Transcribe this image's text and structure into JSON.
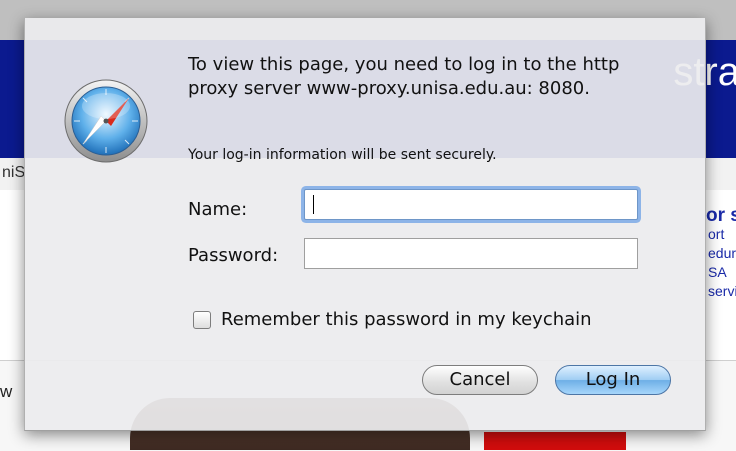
{
  "background": {
    "banner_text": "stra",
    "nav_text": "niS",
    "right_heading": "or s",
    "right_lines": [
      "ort",
      "edure",
      "SA",
      "servi"
    ],
    "lower_left_text": "w"
  },
  "dialog": {
    "title": "To view this page, you need to log in to the http proxy server www-proxy.unisa.edu.au: 8080.",
    "secure_note": "Your log-in information will be sent securely.",
    "name_label": "Name:",
    "name_value": "",
    "password_label": "Password:",
    "password_value": "",
    "remember_label": "Remember this password in my keychain",
    "remember_checked": false,
    "cancel_label": "Cancel",
    "login_label": "Log In"
  },
  "colors": {
    "banner": "#0b1a8f",
    "default_button": "#6eafe6",
    "focus_ring": "#8db4e8"
  },
  "icons": {
    "app_icon": "safari-compass-icon"
  }
}
